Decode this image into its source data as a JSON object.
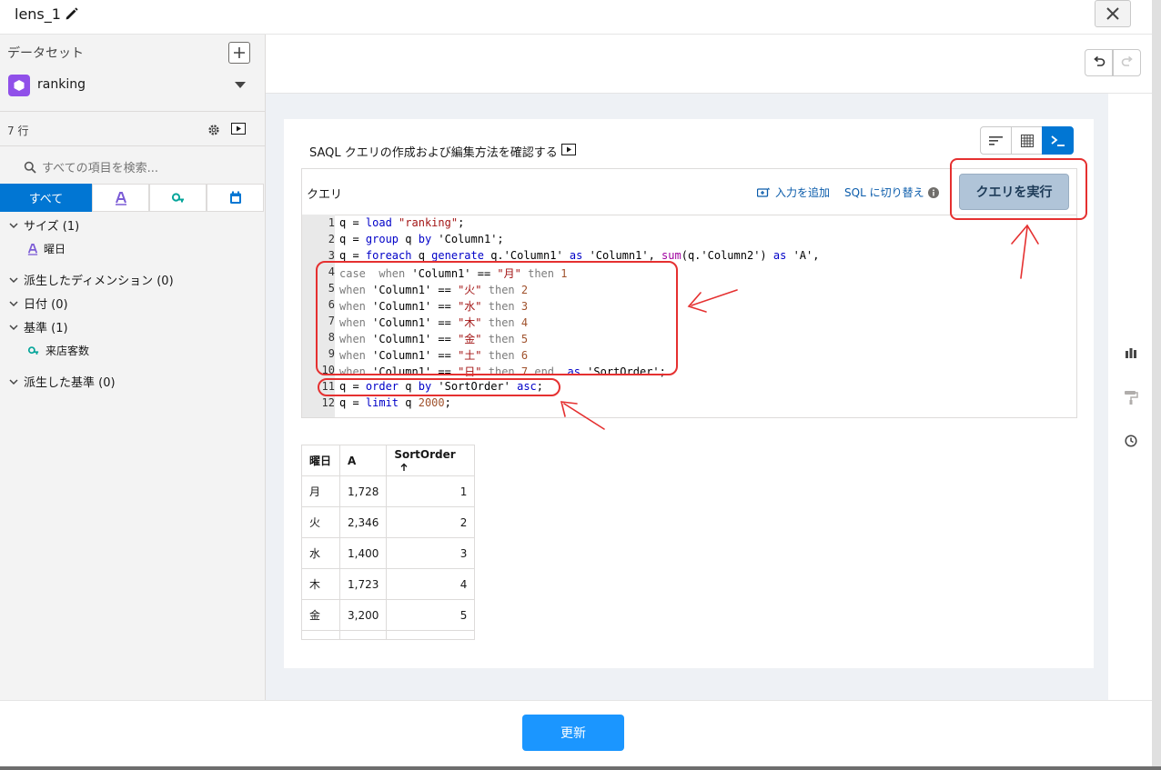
{
  "header": {
    "title": "lens_1"
  },
  "left": {
    "dataset_heading": "データセット",
    "dataset_name": "ranking",
    "row_count": "7 行",
    "search_placeholder": "すべての項目を検索...",
    "filter_all": "すべて",
    "groups": [
      {
        "label": "サイズ (1)",
        "children": [
          "曜日"
        ]
      },
      {
        "label": "派生したディメンション (0)",
        "children": []
      },
      {
        "label": "日付 (0)",
        "children": []
      },
      {
        "label": "基準 (1)",
        "children": [
          "来店客数"
        ]
      },
      {
        "label": "派生した基準 (0)",
        "children": []
      }
    ]
  },
  "main": {
    "help_text": "SAQL クエリの作成および編集方法を確認する",
    "query_label": "クエリ",
    "add_input": "入力を追加",
    "sql_toggle": "SQL に切り替え",
    "run_query": "クエリを実行"
  },
  "code_lines": [
    "q = load \"ranking\";",
    "q = group q by 'Column1';",
    "q = foreach q generate q.'Column1' as 'Column1', sum(q.'Column2') as 'A',",
    "case  when 'Column1' == \"月\" then 1",
    "when 'Column1' == \"火\" then 2",
    "when 'Column1' == \"水\" then 3",
    "when 'Column1' == \"木\" then 4",
    "when 'Column1' == \"金\" then 5",
    "when 'Column1' == \"土\" then 6",
    "when 'Column1' == \"日\" then 7 end  as 'SortOrder';",
    "q = order q by 'SortOrder' asc;",
    "q = limit q 2000;"
  ],
  "table": {
    "headers": [
      "曜日",
      "A",
      "SortOrder"
    ],
    "rows": [
      [
        "月",
        "1,728",
        "1"
      ],
      [
        "火",
        "2,346",
        "2"
      ],
      [
        "水",
        "1,400",
        "3"
      ],
      [
        "木",
        "1,723",
        "4"
      ],
      [
        "金",
        "3,200",
        "5"
      ]
    ]
  },
  "footer": {
    "update_label": "更新"
  },
  "icons": {
    "edit": "pencil-icon",
    "close": "close-icon",
    "add": "plus-icon",
    "dataset": "dataset-icon",
    "settings": "gear-icon",
    "play": "play-icon",
    "search": "search-icon",
    "undo": "undo-icon",
    "redo": "redo-icon",
    "chart_view": "chart-view-icon",
    "table_view": "table-view-icon",
    "query_view": "query-view-icon",
    "bar_chart": "bar-chart-icon",
    "paint": "paint-roller-icon",
    "history": "clock-icon"
  },
  "colors": {
    "brand": "#0176d3",
    "update_button": "#1b96ff",
    "annotation": "#e53030"
  }
}
